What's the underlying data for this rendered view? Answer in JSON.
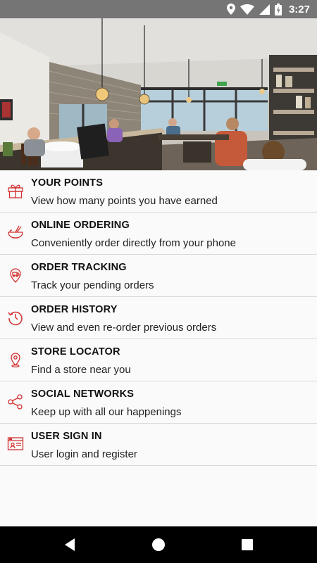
{
  "status_bar": {
    "time": "3:27",
    "icons": [
      "location-icon",
      "wifi-icon",
      "signal-icon",
      "battery-icon"
    ]
  },
  "hero": {
    "description_icon": "restaurant-interior-photo"
  },
  "menu": {
    "accent_color": "#d32f2f",
    "items": [
      {
        "title": "YOUR POINTS",
        "subtitle": "View how many points you have earned",
        "icon": "gift-icon"
      },
      {
        "title": "ONLINE ORDERING",
        "subtitle": "Conveniently order directly from your phone",
        "icon": "bowl-icon"
      },
      {
        "title": "ORDER TRACKING",
        "subtitle": "Track your pending orders",
        "icon": "map-pin-icon"
      },
      {
        "title": "ORDER HISTORY",
        "subtitle": "View and even re-order previous orders",
        "icon": "history-icon"
      },
      {
        "title": "STORE LOCATOR",
        "subtitle": "Find a store near you",
        "icon": "location-pin-icon"
      },
      {
        "title": "SOCIAL NETWORKS",
        "subtitle": "Keep up with all our happenings",
        "icon": "share-icon"
      },
      {
        "title": "USER SIGN IN",
        "subtitle": "User login and register",
        "icon": "login-icon"
      }
    ]
  },
  "nav_bar": {
    "buttons": [
      "back-icon",
      "home-icon",
      "recent-apps-icon"
    ]
  }
}
